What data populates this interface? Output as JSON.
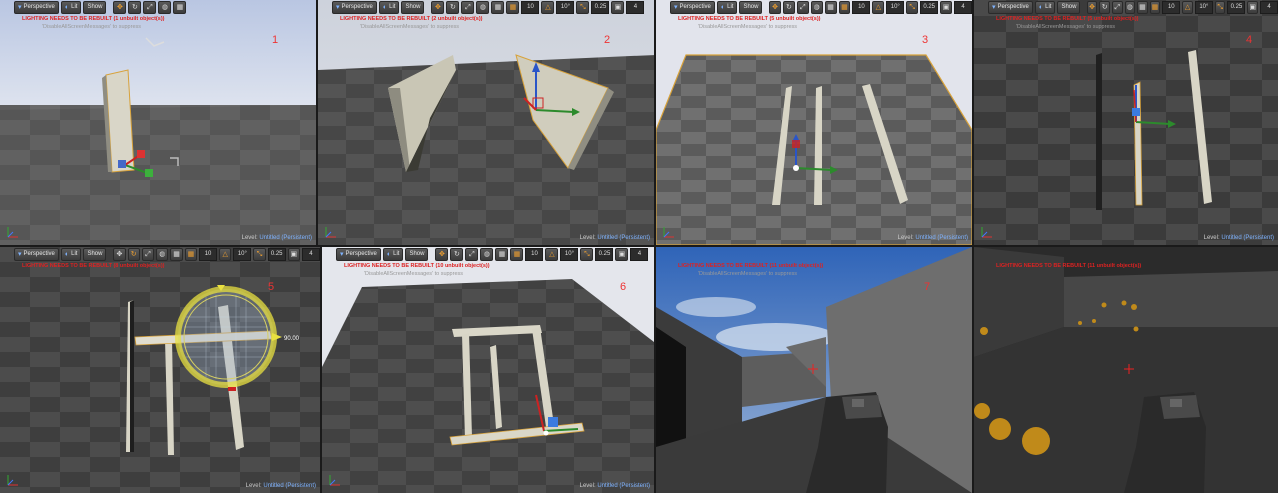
{
  "toolbar": {
    "perspective": "Perspective",
    "lit": "Lit",
    "show": "Show",
    "grid_snap": "10",
    "rot_snap": "10°",
    "scale_snap": "0.25",
    "cam_speed": "4"
  },
  "hint": "'DisableAllScreenMessages' to suppress",
  "level": {
    "prefix": "Level:",
    "name": "Untitled (Persistent)"
  },
  "viewports": [
    {
      "index": "1",
      "warning": "LIGHTING NEEDS TO BE REBUILT (1 unbuilt object(s))"
    },
    {
      "index": "2",
      "warning": "LIGHTING NEEDS TO BE REBUILT (2 unbuilt object(s))"
    },
    {
      "index": "3",
      "warning": "LIGHTING NEEDS TO BE REBUILT (5 unbuilt object(s))"
    },
    {
      "index": "4",
      "warning": "LIGHTING NEEDS TO BE REBUILT (5 unbuilt object(s))"
    },
    {
      "index": "5",
      "warning": "LIGHTING NEEDS TO BE REBUILT (8 unbuilt object(s))",
      "rotation_readout": "90.00"
    },
    {
      "index": "6",
      "warning": "LIGHTING NEEDS TO BE REBUILT (10 unbuilt object(s))"
    },
    {
      "index": "7",
      "warning": "LIGHTING NEEDS TO BE REBUILT (11 unbuilt object(s))"
    },
    {
      "index": "8",
      "warning": "LIGHTING NEEDS TO BE REBUILT (11 unbuilt object(s))"
    }
  ],
  "colors": {
    "selection": "#d8a23a",
    "warning": "#dd2222",
    "accent": "#7fb3ff"
  }
}
